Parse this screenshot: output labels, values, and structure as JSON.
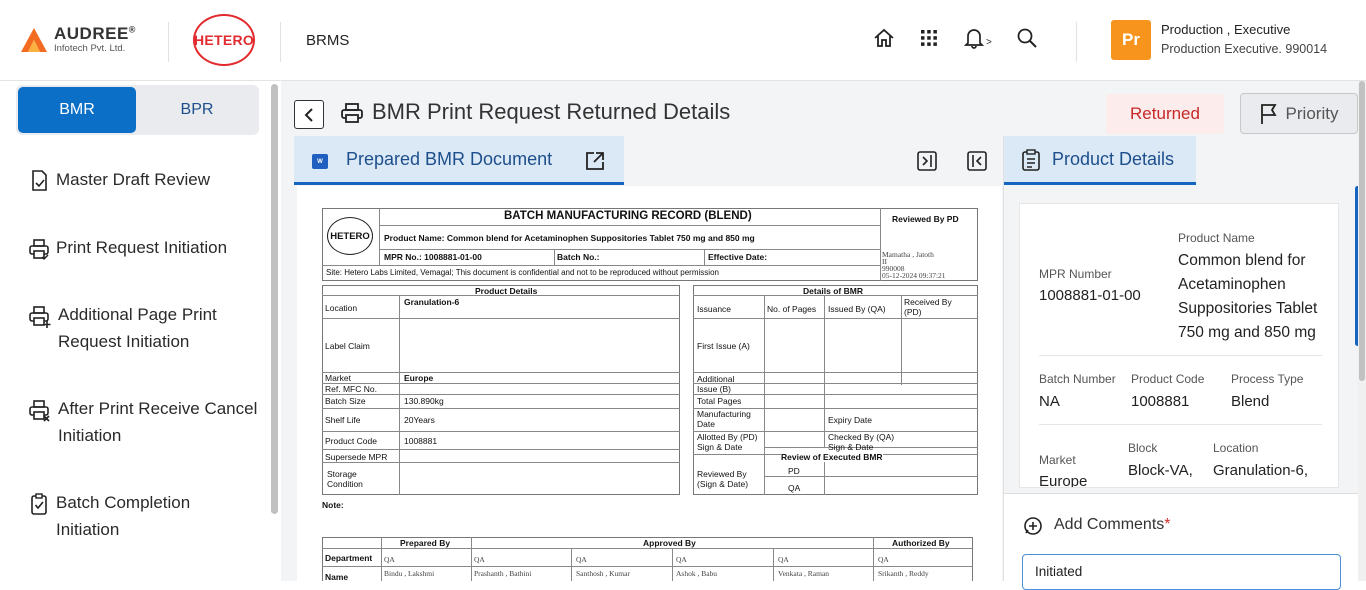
{
  "header": {
    "brand_name": "AUDREE",
    "brand_reg": "®",
    "brand_sub": "Infotech Pvt. Ltd.",
    "partner_logo": "HETERO",
    "app_name": "BRMS",
    "user_avatar": "Pr",
    "user_name": "Production , Executive",
    "user_role": "Production Executive. 990014",
    "notif_suffix": ">"
  },
  "sidebar": {
    "tabs": [
      {
        "label": "BMR"
      },
      {
        "label": "BPR"
      }
    ],
    "items": [
      {
        "line1": "Master Draft Review",
        "line2": ""
      },
      {
        "line1": "Print Request Initiation",
        "line2": ""
      },
      {
        "line1": "Additional Page Print",
        "line2": "Request Initiation"
      },
      {
        "line1": "After Print Receive Cancel",
        "line2": "Initiation"
      },
      {
        "line1": "Batch Completion",
        "line2": "Initiation"
      }
    ]
  },
  "page": {
    "title": "BMR Print Request Returned Details",
    "status": "Returned",
    "priority_label": "Priority",
    "doc_tab": "Prepared BMR Document",
    "product_tab": "Product Details"
  },
  "product": {
    "mpr_label": "MPR Number",
    "mpr_value": "1008881-01-00",
    "name_label": "Product Name",
    "name_value": "Common blend for Acetaminophen Suppositories Tablet 750 mg and 850 mg",
    "batch_label": "Batch Number",
    "batch_value": "NA",
    "code_label": "Product Code",
    "code_value": "1008881",
    "process_label": "Process Type",
    "process_value": "Blend",
    "market_label": "Market",
    "market_value": "Europe",
    "block_label": "Block",
    "block_value": "Block-VA,",
    "location_label": "Location",
    "location_value": "Granulation-6,"
  },
  "comments": {
    "title": "Add Comments",
    "required_mark": "*",
    "value": "Initiated"
  },
  "doc": {
    "logo": "HETERO",
    "title": "BATCH MANUFACTURING RECORD (BLEND)",
    "reviewed_by": "Reviewed By PD",
    "product_name": "Product Name: Common blend for Acetaminophen Suppositories Tablet 750 mg and 850 mg",
    "mpr_no": "MPR No.: 1008881-01-00",
    "batch_no": "Batch No.:",
    "effective_date": "Effective Date:",
    "site": "Site: Hetero Labs Limited, Vemagal; This document is confidential and not to be reproduced without permission",
    "reviewer_name": "Mamatha , Jatoth",
    "reviewer_line2": "II",
    "reviewer_id": "990008",
    "reviewer_ts": "05-12-2024 09:37:21",
    "product_details_title": "Product Details",
    "bmr_details_title": "Details of BMR",
    "location_label": "Location",
    "location_value": "Granulation-6",
    "label_claim": "Label Claim",
    "market_label": "Market",
    "market_value": "Europe",
    "ref_mfc": "Ref. MFC No.",
    "batch_size_label": "Batch Size",
    "batch_size_value": "130.890kg",
    "shelf_life_label": "Shelf Life",
    "shelf_life_value": "20Years",
    "product_code_label": "Product Code",
    "product_code_value": "1008881",
    "supersede": "Supersede MPR",
    "storage1": "Storage",
    "storage2": "Condition",
    "issuance": "Issuance",
    "no_pages": "No. of Pages",
    "issued_by": "Issued By (QA)",
    "received_by1": "Received By",
    "received_by2": "(PD)",
    "first_issue": "First Issue (A)",
    "additional1": "Additional",
    "additional2": "Issue (B)",
    "total_pages": "Total Pages",
    "mfg_date1": "Manufacturing",
    "mfg_date2": "Date",
    "expiry": "Expiry Date",
    "allotted1": "Allotted By (PD)",
    "allotted2": "Sign & Date",
    "checked1": "Checked By (QA)",
    "checked2": "Sign & Date",
    "review_exec": "Review of Executed BMR",
    "reviewed_by1": "Reviewed By",
    "reviewed_by2": "(Sign & Date)",
    "pd": "PD",
    "qa": "QA",
    "note": "Note:",
    "prepared_by": "Prepared By",
    "approved_by": "Approved By",
    "authorized_by": "Authorized By",
    "department": "Department",
    "name": "Name",
    "sign_qa": [
      "QA",
      "QA",
      "QA",
      "QA",
      "QA",
      "QA"
    ],
    "sign_names": [
      "Bindu , Lakshmi",
      "Prashanth , Bathini",
      "Santhosh , Kumar",
      "Ashok , Babu",
      "Venkata , Raman",
      "Srikanth , Reddy"
    ]
  }
}
